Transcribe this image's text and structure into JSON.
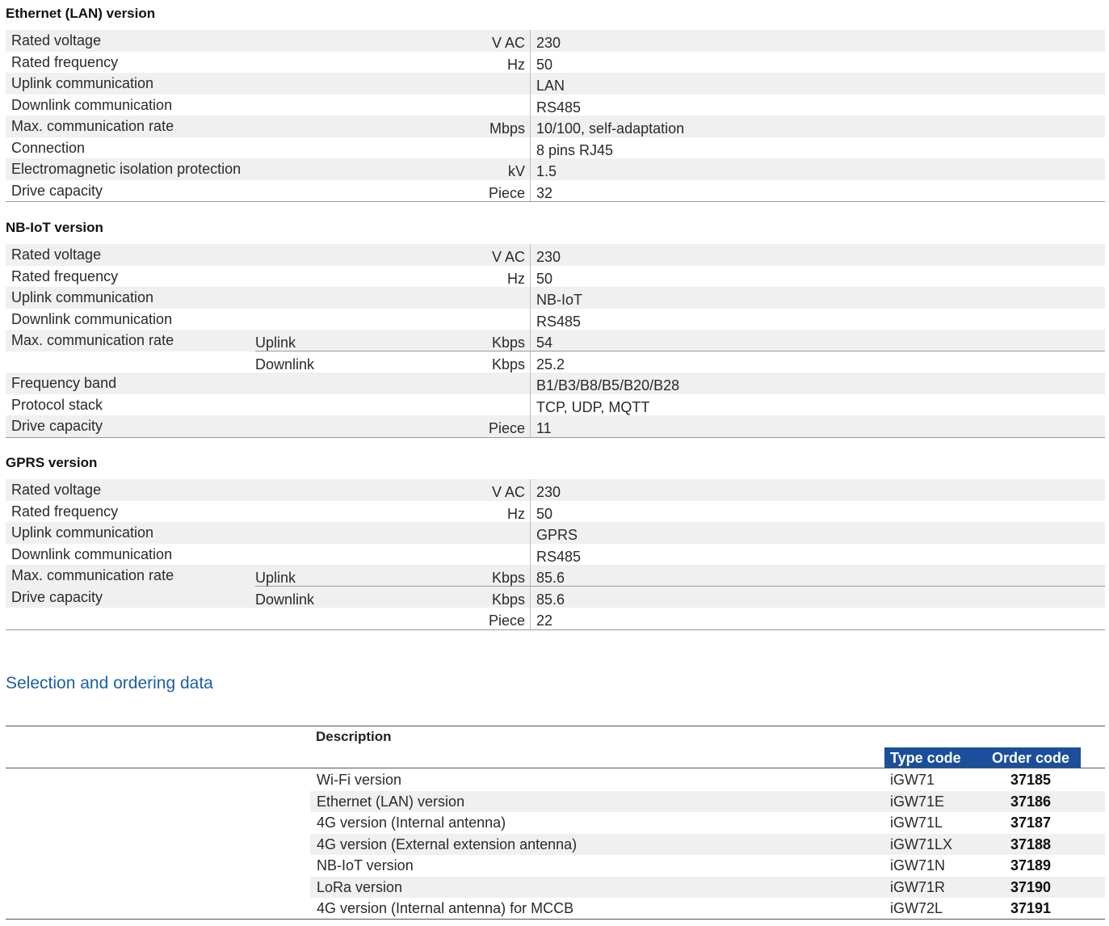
{
  "ethernet": {
    "title": "Ethernet (LAN) version",
    "rows": [
      {
        "param": "Rated voltage",
        "sub": "",
        "unit": "V AC",
        "value": "230"
      },
      {
        "param": "Rated frequency",
        "sub": "",
        "unit": "Hz",
        "value": "50"
      },
      {
        "param": "Uplink communication",
        "sub": "",
        "unit": "",
        "value": "LAN"
      },
      {
        "param": "Downlink communication",
        "sub": "",
        "unit": "",
        "value": "RS485"
      },
      {
        "param": "Max. communication rate",
        "sub": "",
        "unit": "Mbps",
        "value": "10/100, self-adaptation"
      },
      {
        "param": "Connection",
        "sub": "",
        "unit": "",
        "value": "8 pins RJ45"
      },
      {
        "param": "Electromagnetic isolation protection",
        "sub": "",
        "unit": "kV",
        "value": "1.5"
      },
      {
        "param": "Drive capacity",
        "sub": "",
        "unit": "Piece",
        "value": "32"
      }
    ]
  },
  "nbiot": {
    "title": "NB-IoT version",
    "rows": [
      {
        "param": "Rated voltage",
        "sub": "",
        "unit": "V AC",
        "value": "230"
      },
      {
        "param": "Rated frequency",
        "sub": "",
        "unit": "Hz",
        "value": "50"
      },
      {
        "param": "Uplink communication",
        "sub": "",
        "unit": "",
        "value": "NB-IoT"
      },
      {
        "param": "Downlink communication",
        "sub": "",
        "unit": "",
        "value": "RS485"
      },
      {
        "param": "Max. communication rate",
        "sub": "Uplink",
        "unit": "Kbps",
        "value": "54"
      },
      {
        "param": "",
        "sub": "Downlink",
        "unit": "Kbps",
        "value": "25.2"
      },
      {
        "param": "Frequency band",
        "sub": "",
        "unit": "",
        "value": "B1/B3/B8/B5/B20/B28"
      },
      {
        "param": "Protocol stack",
        "sub": "",
        "unit": "",
        "value": "TCP, UDP, MQTT"
      },
      {
        "param": "Drive capacity",
        "sub": "",
        "unit": "Piece",
        "value": "11"
      }
    ]
  },
  "gprs": {
    "title": "GPRS version",
    "rows": [
      {
        "param": "Rated voltage",
        "sub": "",
        "unit": "V AC",
        "value": "230"
      },
      {
        "param": "Rated frequency",
        "sub": "",
        "unit": "Hz",
        "value": "50"
      },
      {
        "param": "Uplink communication",
        "sub": "",
        "unit": "",
        "value": "GPRS"
      },
      {
        "param": "Downlink communication",
        "sub": "",
        "unit": "",
        "value": "RS485"
      },
      {
        "param": "Max. communication rate",
        "sub": "Uplink",
        "unit": "Kbps",
        "value": "85.6"
      },
      {
        "param": "Drive capacity",
        "sub": "Downlink",
        "unit": "Kbps",
        "value": "85.6"
      },
      {
        "param": "",
        "sub": "",
        "unit": "Piece",
        "value": "22"
      }
    ]
  },
  "ordering": {
    "heading": "Selection and ordering data",
    "description_header": "Description",
    "type_code_header": "Type code",
    "order_code_header": "Order code",
    "rows": [
      {
        "description": "Wi-Fi version",
        "type_code": "iGW71",
        "order_code": "37185"
      },
      {
        "description": "Ethernet (LAN) version",
        "type_code": "iGW71E",
        "order_code": "37186"
      },
      {
        "description": "4G version (Internal antenna)",
        "type_code": "iGW71L",
        "order_code": "37187"
      },
      {
        "description": "4G version (External extension antenna)",
        "type_code": "iGW71LX",
        "order_code": "37188"
      },
      {
        "description": "NB-IoT version",
        "type_code": "iGW71N",
        "order_code": "37189"
      },
      {
        "description": "LoRa version",
        "type_code": "iGW71R",
        "order_code": "37190"
      },
      {
        "description": "4G version (Internal antenna) for MCCB",
        "type_code": "iGW72L",
        "order_code": "37191"
      }
    ]
  },
  "colors": {
    "accent_blue": "#1b4f9c",
    "heading_blue": "#1a5fa8",
    "row_shade": "#f0f0f0"
  }
}
